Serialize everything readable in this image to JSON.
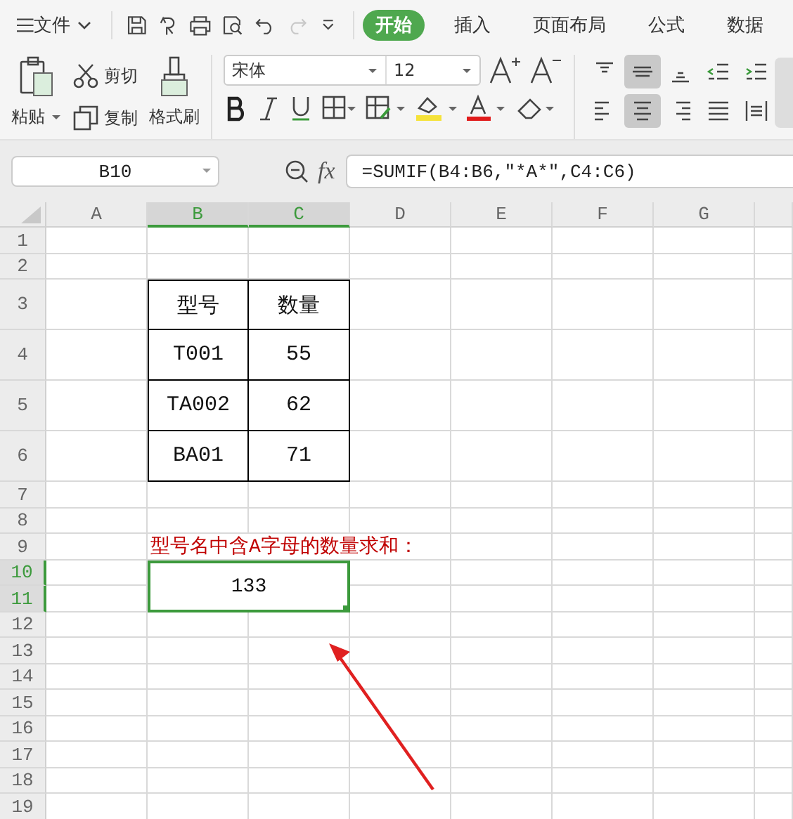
{
  "menu": {
    "file_label": "文件",
    "quick_access": [
      {
        "disabled": false
      },
      {
        "disabled": false
      },
      {
        "disabled": false
      },
      {
        "disabled": false
      },
      {
        "disabled": false
      },
      {
        "disabled": true
      },
      {
        "disabled": false
      }
    ],
    "tabs": [
      {
        "label": "开始",
        "selected": true
      },
      {
        "label": "插入",
        "selected": false
      },
      {
        "label": "页面布局",
        "selected": false
      },
      {
        "label": "公式",
        "selected": false
      },
      {
        "label": "数据",
        "selected": false
      }
    ]
  },
  "ribbon": {
    "clipboard": {
      "paste": "粘贴",
      "cut": "剪切",
      "copy": "复制",
      "format_painter": "格式刷"
    },
    "font": {
      "name": "宋体",
      "size": "12"
    },
    "alignment": [
      {
        "selected": false
      },
      {
        "selected": true
      },
      {
        "selected": false
      },
      {
        "selected": false
      },
      {
        "selected": false
      },
      {
        "selected": false
      },
      {
        "selected": true
      },
      {
        "selected": false
      },
      {
        "selected": false
      },
      {
        "selected": false
      }
    ]
  },
  "formula_bar": {
    "name_box": "B10",
    "function_label": "fx",
    "formula": "=SUMIF(B4:B6,\"*A*\",C4:C6)"
  },
  "sheet": {
    "columns": [
      {
        "label": "A",
        "selected": false
      },
      {
        "label": "B",
        "selected": true
      },
      {
        "label": "C",
        "selected": true
      },
      {
        "label": "D",
        "selected": false
      },
      {
        "label": "E",
        "selected": false
      },
      {
        "label": "F",
        "selected": false
      },
      {
        "label": "G",
        "selected": false
      }
    ],
    "rows": [
      {
        "label": "1",
        "selected": false
      },
      {
        "label": "2",
        "selected": false
      },
      {
        "label": "3",
        "selected": false,
        "cells": {
          "B": {
            "kind": "table",
            "text": "型号"
          },
          "C": {
            "kind": "table",
            "text": "数量"
          }
        }
      },
      {
        "label": "4",
        "selected": false,
        "cells": {
          "B": {
            "kind": "table",
            "text": "T001"
          },
          "C": {
            "kind": "table",
            "text": "55"
          }
        }
      },
      {
        "label": "5",
        "selected": false,
        "cells": {
          "B": {
            "kind": "table",
            "text": "TA002"
          },
          "C": {
            "kind": "table",
            "text": "62"
          }
        }
      },
      {
        "label": "6",
        "selected": false,
        "cells": {
          "B": {
            "kind": "table",
            "text": "BA01"
          },
          "C": {
            "kind": "table",
            "text": "71"
          }
        }
      },
      {
        "label": "7",
        "selected": false
      },
      {
        "label": "8",
        "selected": false
      },
      {
        "label": "9",
        "selected": false,
        "cells": {
          "B": {
            "kind": "note",
            "text": "型号名中含A字母的数量求和："
          }
        }
      },
      {
        "label": "10",
        "selected": true,
        "cells": {
          "B": {
            "kind": "merged",
            "text": "133"
          }
        }
      },
      {
        "label": "11",
        "selected": true
      },
      {
        "label": "12",
        "selected": false
      },
      {
        "label": "13",
        "selected": false
      },
      {
        "label": "14",
        "selected": false
      },
      {
        "label": "15",
        "selected": false
      },
      {
        "label": "16",
        "selected": false
      },
      {
        "label": "17",
        "selected": false
      },
      {
        "label": "18",
        "selected": false
      },
      {
        "label": "19",
        "selected": false
      }
    ]
  }
}
